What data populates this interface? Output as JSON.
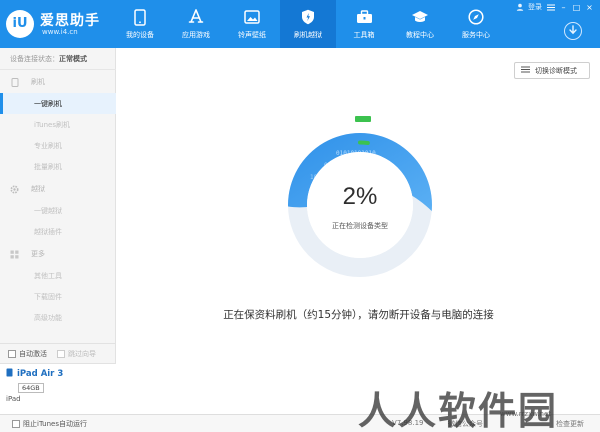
{
  "app": {
    "logo_text": "iU",
    "brand_name": "爱思助手",
    "brand_url": "www.i4.cn"
  },
  "nav": {
    "items": [
      {
        "label": "我的设备",
        "icon": "phone-icon"
      },
      {
        "label": "应用游戏",
        "icon": "app-store-icon"
      },
      {
        "label": "铃声壁纸",
        "icon": "image-icon"
      },
      {
        "label": "刷机越狱",
        "icon": "shield-icon",
        "active": true
      },
      {
        "label": "工具箱",
        "icon": "toolbox-icon"
      },
      {
        "label": "教程中心",
        "icon": "graduation-cap-icon"
      },
      {
        "label": "服务中心",
        "icon": "compass-icon"
      }
    ]
  },
  "window": {
    "login_label": "登录",
    "minimize": "–",
    "maximize": "□",
    "close": "×"
  },
  "sidebar": {
    "status_prefix": "设备连接状态：",
    "status_value": "正常模式",
    "sections": [
      {
        "label": "刷机",
        "icon": "phone-outline-icon"
      },
      {
        "label": "越狱",
        "icon": "gear-icon"
      },
      {
        "label": "更多",
        "icon": "grid-icon"
      }
    ],
    "items": {
      "flash": [
        "一键刷机",
        "iTunes刷机",
        "专业刷机",
        "批量刷机"
      ],
      "jailbreak": [
        "一键越狱",
        "越狱插件"
      ],
      "more": [
        "其他工具",
        "下载固件",
        "高级功能"
      ]
    },
    "auto_activate": "自动激活",
    "skip_guide": "跳过向导",
    "device": {
      "name": "iPad Air 3",
      "capacity": "64GB",
      "type": "iPad"
    }
  },
  "main": {
    "diag_mode_button": "切换诊断模式",
    "progress_text": "2%",
    "status_text": "正在检测设备类型",
    "message": "正在保资料刷机（约15分钟），请勿断开设备与电脑的连接",
    "progress_value": 0.02
  },
  "footer": {
    "itunes_autorun": "阻止iTunes自动运行",
    "version": "V7.98.19",
    "wechat": "微信公众号",
    "check_update": "检查更新"
  },
  "watermark": {
    "text": "人人软件园",
    "url": "www.rrzxw.net"
  },
  "colors": {
    "brand_blue": "#1f8fea",
    "nav_active": "#1478d4",
    "progress_green": "#3cc24f",
    "ring_track": "#e7eef6"
  }
}
